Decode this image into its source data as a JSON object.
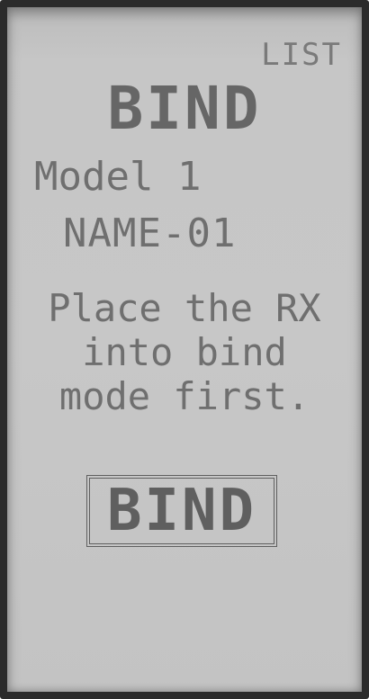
{
  "header": {
    "list_label": "LIST"
  },
  "screen": {
    "title": "BIND",
    "model": "Model 1",
    "model_name": "NAME-01",
    "message_lines": [
      "Place the RX",
      "into bind",
      "mode first."
    ]
  },
  "actions": {
    "bind_label": "BIND"
  },
  "colors": {
    "lcd_background": "#c6c6c6",
    "lcd_text": "#6f6f6f",
    "bezel": "#2b2b2b"
  }
}
